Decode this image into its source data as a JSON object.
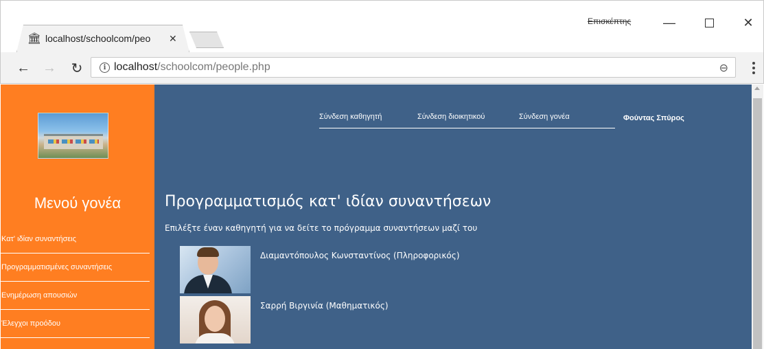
{
  "browser": {
    "tab_title": "localhost/schoolcom/peo",
    "tab_close": "✕",
    "user_label": "Επισκέπτης",
    "url_host": "localhost",
    "url_path": "/schoolcom/people.php",
    "icons": {
      "favicon": "bank-icon",
      "back": "back-arrow-icon",
      "forward": "forward-arrow-icon",
      "reload": "reload-icon",
      "info": "info-icon",
      "zoom": "zoom-icon",
      "menu": "kebab-menu-icon"
    }
  },
  "sidebar": {
    "title": "Μενού γονέα",
    "items": [
      "Κατ' ιδίαν συναντήσεις",
      "Προγραμματισμένες συναντήσεις",
      "Ενημέρωση απουσιών",
      "Έλεγχοι προόδου"
    ]
  },
  "topnav": {
    "links": [
      "Σύνδεση καθηγητή",
      "Σύνδεση διοικητικού",
      "Σύνδεση γονέα"
    ],
    "user": "Φούντας Σπύρος"
  },
  "main": {
    "heading": "Προγραμματισμός κατ' ιδίαν συναντήσεων",
    "subheading": "Επιλέξτε έναν καθηγητή για να δείτε το πρόγραμμα συναντήσεων μαζί του",
    "teachers": [
      "Διαμαντόπουλος Κωνσταντίνος (Πληροφορικός)",
      "Σαρρή Βιργινία (Μαθηματικός)"
    ]
  },
  "colors": {
    "sidebar": "#ff7e21",
    "page_background": "#3f6188",
    "text": "#ffffff"
  }
}
